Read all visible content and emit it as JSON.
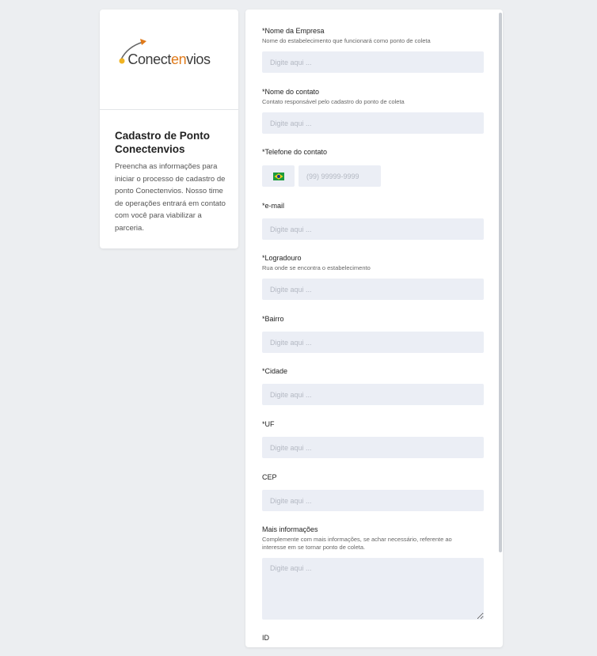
{
  "sidebar": {
    "logo_prefix": "Conect",
    "logo_accent": "en",
    "logo_suffix": "vios",
    "title": "Cadastro de Ponto Conectenvios",
    "description": "Preencha as informações para iniciar o processo de cadastro de ponto Conectenvios. Nosso time de operações entrará em contato com você para viabilizar a parceria."
  },
  "form": {
    "company_name": {
      "label": "*Nome da Empresa",
      "help": "Nome do estabelecimento que funcionará como ponto de coleta",
      "placeholder": "Digite aqui ..."
    },
    "contact_name": {
      "label": "*Nome do contato",
      "help": "Contato responsável pelo cadastro do ponto de coleta",
      "placeholder": "Digite aqui ..."
    },
    "phone": {
      "label": "*Telefone do contato",
      "placeholder": "(99) 99999-9999",
      "country_flag": "brazil-flag-icon"
    },
    "email": {
      "label": "*e-mail",
      "placeholder": "Digite aqui ..."
    },
    "street": {
      "label": "*Logradouro",
      "help": "Rua onde se encontra o estabelecimento",
      "placeholder": "Digite aqui ..."
    },
    "district": {
      "label": "*Bairro",
      "placeholder": "Digite aqui ..."
    },
    "city": {
      "label": "*Cidade",
      "placeholder": "Digite aqui ..."
    },
    "state": {
      "label": "*UF",
      "placeholder": "Digite aqui ..."
    },
    "zip": {
      "label": "CEP",
      "placeholder": "Digite aqui ..."
    },
    "more_info": {
      "label": "Mais informações",
      "help": "Complemente com mais informações, se achar necessário, referente ao interesse em se tornar ponto de coleta.",
      "placeholder": "Digite aqui ..."
    },
    "id_label": "ID"
  },
  "colors": {
    "background": "#eceef1",
    "input_bg": "#ebeef5",
    "logo_accent": "#e07a1a"
  }
}
